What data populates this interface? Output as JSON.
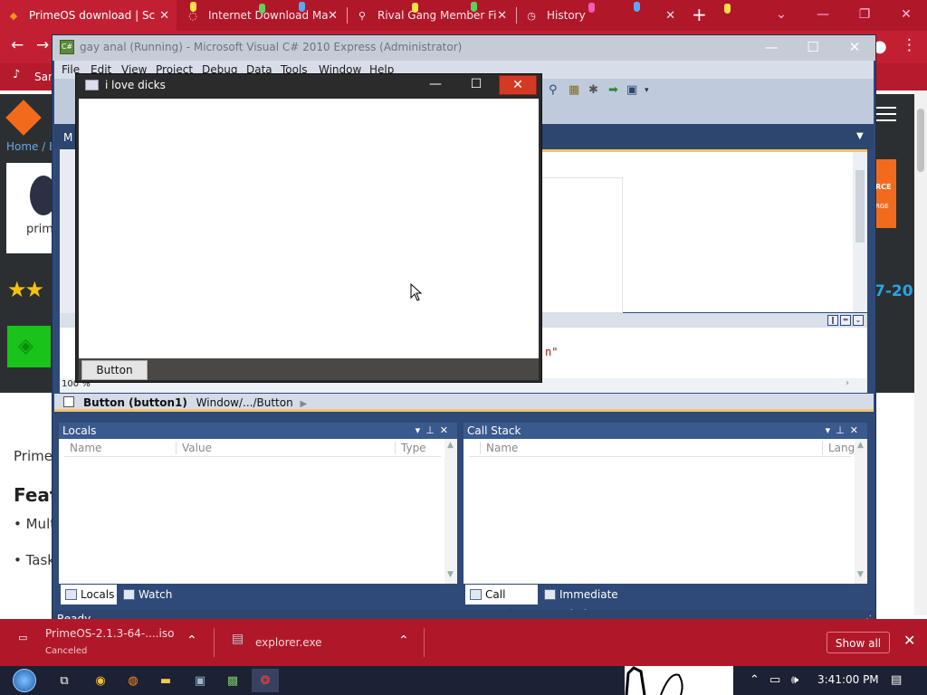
{
  "browser": {
    "tabs": [
      {
        "title": "PrimeOS download | Sc",
        "active": true
      },
      {
        "title": "Internet Download Ma",
        "active": false
      },
      {
        "title": "Rival Gang Member Fi",
        "active": false
      },
      {
        "title": "History",
        "active": false
      }
    ],
    "bookmark_fragment": "Sar",
    "colors": {
      "frame": "#b0182a",
      "accent": "#c21f32"
    }
  },
  "website": {
    "breadcrumb": "Home / B",
    "logo_text": "prim",
    "headline_date": "7-20",
    "badge_line1": "RCE",
    "badge_line2": "RGE",
    "text_prime": "Prime",
    "text_feat": "Feat",
    "bullet_1": "• Mult",
    "bullet_2": "• Task"
  },
  "vs": {
    "title": "gay anal (Running) - Microsoft Visual C# 2010 Express (Administrator)",
    "menu": [
      "File",
      "Edit",
      "View",
      "Project",
      "Debug",
      "Data",
      "Tools",
      "Window",
      "Help"
    ],
    "doc_tab": "M",
    "code_snippet": "n\"",
    "zoom": "100 %",
    "selection": {
      "name": "Button (button1)",
      "path": "Window/.../Button"
    },
    "locals": {
      "title": "Locals",
      "columns": [
        "Name",
        "Value",
        "Type"
      ]
    },
    "callstack": {
      "title": "Call Stack",
      "columns": [
        "Name",
        "Lang"
      ]
    },
    "bottom_tabs_left": [
      {
        "label": "Locals",
        "active": true
      },
      {
        "label": "Watch",
        "active": false
      }
    ],
    "bottom_tabs_right": [
      {
        "label": "Call Stack",
        "active": true
      },
      {
        "label": "Immediate Window",
        "active": false
      }
    ],
    "status": "Ready"
  },
  "form": {
    "title": "i love dicks",
    "button_label": "Button"
  },
  "downloads": {
    "items": [
      {
        "name": "PrimeOS-2.1.3-64-....iso",
        "status": "Canceled"
      },
      {
        "name": "explorer.exe",
        "status": ""
      }
    ],
    "show_all": "Show all"
  },
  "taskbar": {
    "clock": "3:41:00 PM"
  }
}
